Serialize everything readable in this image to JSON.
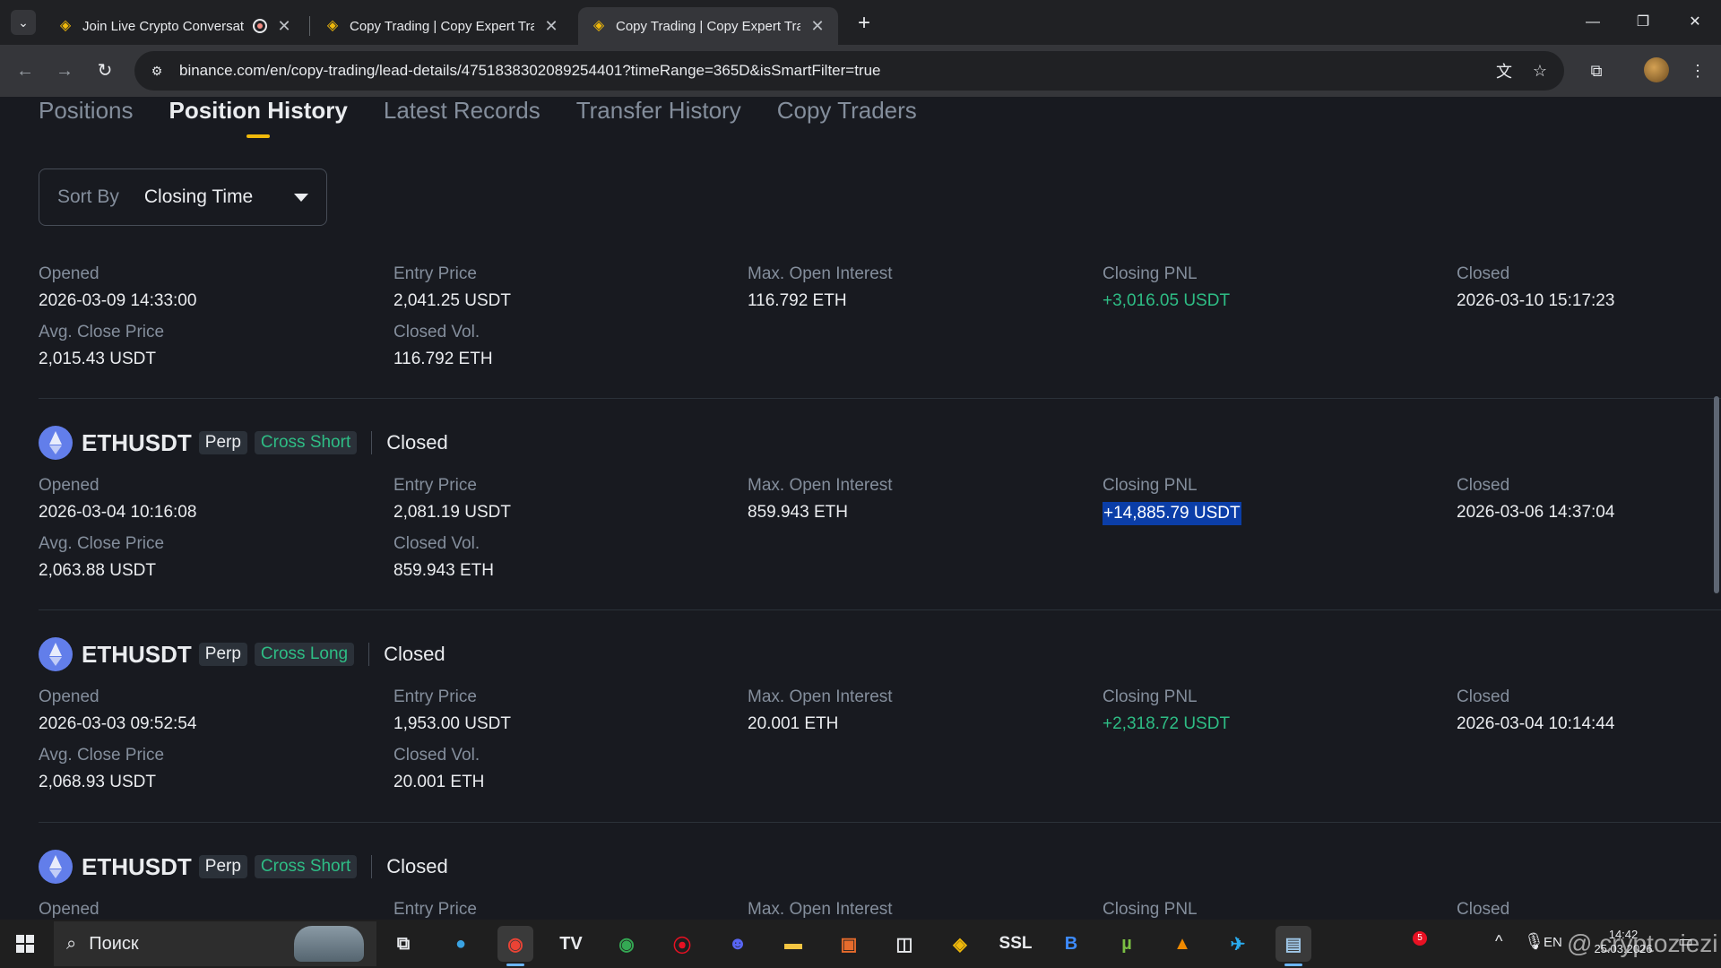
{
  "browser": {
    "tabs": [
      {
        "title": "Join Live Crypto Conversati",
        "active": false,
        "recording": true
      },
      {
        "title": "Copy Trading | Copy Expert Trac",
        "active": false,
        "recording": false
      },
      {
        "title": "Copy Trading | Copy Expert Trac",
        "active": true,
        "recording": false
      }
    ],
    "url": "binance.com/en/copy-trading/lead-details/4751838302089254401?timeRange=365D&isSmartFilter=true",
    "icons": {
      "tab_favicon": "binance-icon",
      "back": "back-arrow-icon",
      "forward": "forward-arrow-icon",
      "reload": "reload-icon",
      "site_info": "tune-icon",
      "translate": "translate-icon",
      "bookmark": "star-icon",
      "extensions": "puzzle-icon",
      "menu": "kebab-menu-icon"
    }
  },
  "page": {
    "subtabs": [
      {
        "label": "Positions",
        "active": false
      },
      {
        "label": "Position History",
        "active": true
      },
      {
        "label": "Latest Records",
        "active": false
      },
      {
        "label": "Transfer History",
        "active": false
      },
      {
        "label": "Copy Traders",
        "active": false
      }
    ],
    "sort": {
      "label": "Sort By",
      "value": "Closing Time"
    },
    "labels": {
      "opened": "Opened",
      "entry_price": "Entry Price",
      "max_open_interest": "Max. Open Interest",
      "closing_pnl": "Closing PNL",
      "closed": "Closed",
      "avg_close_price": "Avg. Close Price",
      "closed_vol": "Closed Vol."
    },
    "records": [
      {
        "symbol": "",
        "type": "",
        "side": "",
        "status": "",
        "opened": "2026-03-09 14:33:00",
        "entry_price": "2,041.25 USDT",
        "max_open_interest": "116.792 ETH",
        "closing_pnl": "+3,016.05 USDT",
        "closed": "2026-03-10 15:17:23",
        "avg_close_price": "2,015.43 USDT",
        "closed_vol": "116.792 ETH"
      },
      {
        "symbol": "ETHUSDT",
        "type": "Perp",
        "side": "Cross Short",
        "status": "Closed",
        "opened": "2026-03-04 10:16:08",
        "entry_price": "2,081.19 USDT",
        "max_open_interest": "859.943 ETH",
        "closing_pnl": "+14,885.79 USDT",
        "closed": "2026-03-06 14:37:04",
        "avg_close_price": "2,063.88 USDT",
        "closed_vol": "859.943 ETH"
      },
      {
        "symbol": "ETHUSDT",
        "type": "Perp",
        "side": "Cross Long",
        "status": "Closed",
        "opened": "2026-03-03 09:52:54",
        "entry_price": "1,953.00 USDT",
        "max_open_interest": "20.001 ETH",
        "closing_pnl": "+2,318.72 USDT",
        "closed": "2026-03-04 10:14:44",
        "avg_close_price": "2,068.93 USDT",
        "closed_vol": "20.001 ETH"
      },
      {
        "symbol": "ETHUSDT",
        "type": "Perp",
        "side": "Cross Short",
        "status": "Closed"
      }
    ],
    "colors": {
      "accent": "#f0b90b",
      "profit": "#2ebd85",
      "background": "#181a20",
      "selection": "#0b3ea8"
    }
  },
  "taskbar": {
    "search_placeholder": "Поиск",
    "ssl_label": "SSL",
    "notification_count": "5",
    "lang": "EN",
    "time": "14:42",
    "date": "25.03.2026",
    "watermark": "@ cryptoziezi"
  }
}
